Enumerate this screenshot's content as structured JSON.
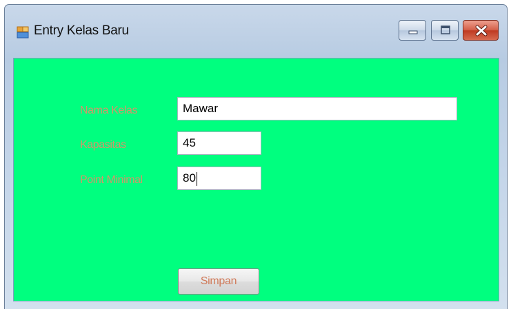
{
  "window": {
    "title": "Entry Kelas Baru",
    "controls": {
      "minimize_icon": "minimize-icon",
      "maximize_icon": "maximize-icon",
      "close_icon": "close-icon"
    }
  },
  "form": {
    "background_color": "#00ff7f",
    "label_color": "#d4956a",
    "fields": [
      {
        "label": "Nama Kelas",
        "value": "Mawar"
      },
      {
        "label": "Kapasitas",
        "value": "45"
      },
      {
        "label": "Point Minimal",
        "value": "80"
      }
    ],
    "submit_label": "Simpan"
  }
}
